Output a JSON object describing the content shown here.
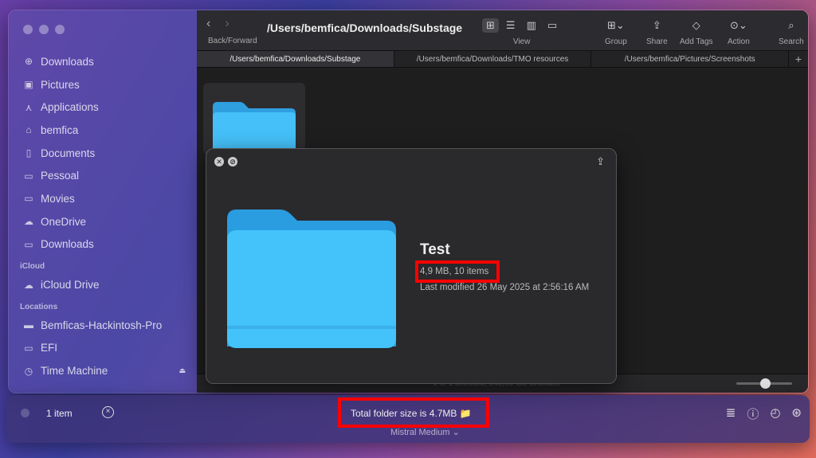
{
  "sidebar": {
    "favorites": [
      {
        "label": "Downloads",
        "icon": "download-icon"
      },
      {
        "label": "Pictures",
        "icon": "photo-icon"
      },
      {
        "label": "Applications",
        "icon": "applications-icon"
      },
      {
        "label": "bemfica",
        "icon": "home-icon"
      },
      {
        "label": "Documents",
        "icon": "document-icon"
      },
      {
        "label": "Pessoal",
        "icon": "folder-icon"
      },
      {
        "label": "Movies",
        "icon": "film-icon"
      },
      {
        "label": "OneDrive",
        "icon": "cloud-icon"
      },
      {
        "label": "Downloads",
        "icon": "folder-icon"
      }
    ],
    "icloud_heading": "iCloud",
    "icloud_items": [
      {
        "label": "iCloud Drive",
        "icon": "icloud-icon"
      }
    ],
    "locations_heading": "Locations",
    "locations": [
      {
        "label": "Bemficas-Hackintosh-Pro",
        "icon": "computer-icon"
      },
      {
        "label": "EFI",
        "icon": "disk-icon"
      },
      {
        "label": "Time Machine",
        "icon": "clock-icon"
      }
    ]
  },
  "toolbar": {
    "back_forward_label": "Back/Forward",
    "path_title": "/Users/bemfica/Downloads/Substage",
    "view_label": "View",
    "group_label": "Group",
    "share_label": "Share",
    "add_tags_label": "Add Tags",
    "action_label": "Action",
    "search_label": "Search"
  },
  "tabs": [
    {
      "label": "/Users/bemfica/Downloads/Substage",
      "active": true
    },
    {
      "label": "/Users/bemfica/Downloads/TMO resources",
      "active": false
    },
    {
      "label": "/Users/bemfica/Pictures/Screenshots",
      "active": false
    }
  ],
  "status_bar": {
    "text": "1 of 1 selected, 248,83 GB available"
  },
  "quicklook": {
    "name": "Test",
    "size": "4,9 MB, 10 items",
    "modified": "Last modified 26 May 2025 at 2:56:16 AM"
  },
  "bottom_bar": {
    "item_count": "1 item",
    "total": "Total folder size is 4.7MB 📁",
    "model": "Mistral Medium ⌄"
  },
  "colors": {
    "highlight": "#ff0000",
    "folder_blue": "#3fb4f5"
  }
}
